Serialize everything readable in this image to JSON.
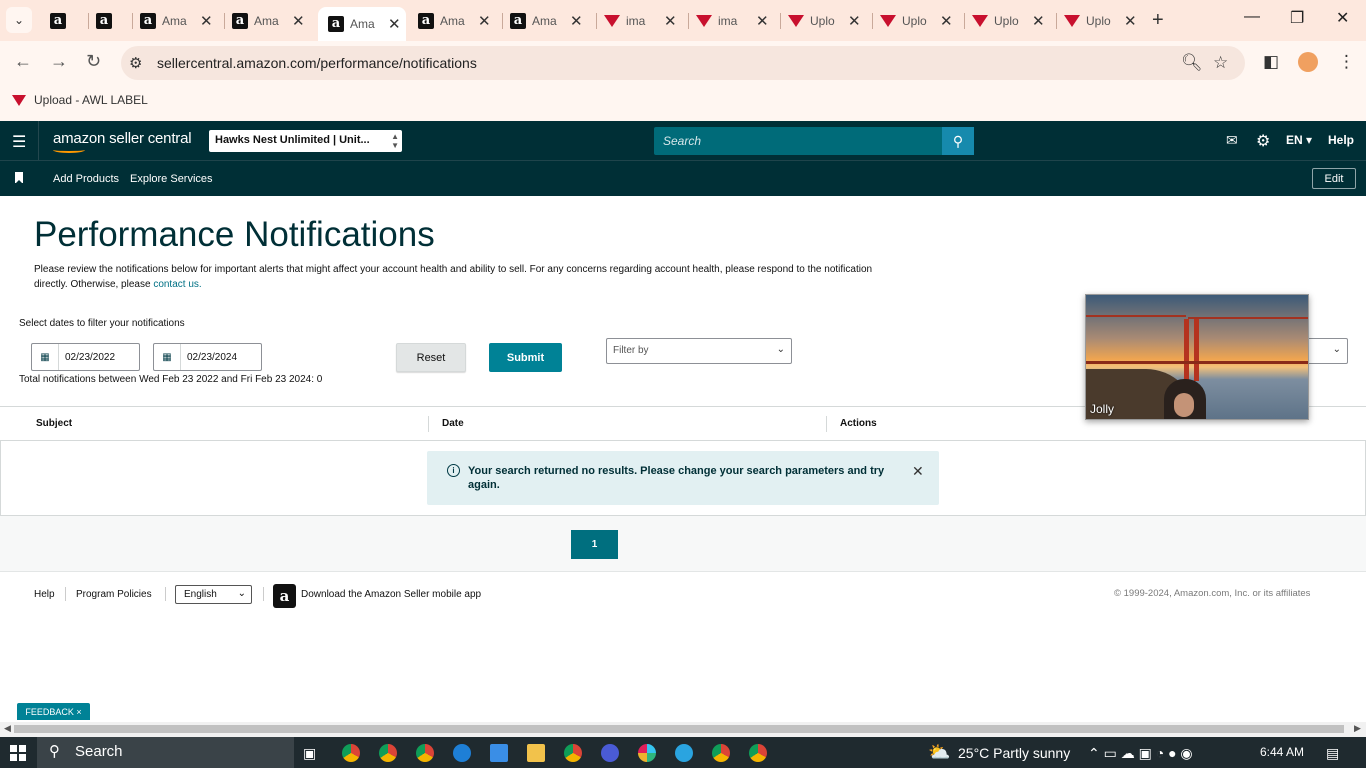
{
  "browser": {
    "tabs": [
      {
        "title": "",
        "icon": "amazon-a-icon"
      },
      {
        "title": "",
        "icon": "amazon-a-icon"
      },
      {
        "title": "Ama",
        "icon": "amazon-a-icon"
      },
      {
        "title": "Ama",
        "icon": "amazon-a-icon"
      },
      {
        "title": "Ama",
        "icon": "amazon-a-icon",
        "active": true
      },
      {
        "title": "Ama",
        "icon": "amazon-a-icon"
      },
      {
        "title": "Ama",
        "icon": "amazon-a-icon"
      },
      {
        "title": "ima",
        "icon": "awl-triangle-icon"
      },
      {
        "title": "ima",
        "icon": "awl-triangle-icon"
      },
      {
        "title": "Uplo",
        "icon": "awl-triangle-icon"
      },
      {
        "title": "Uplo",
        "icon": "awl-triangle-icon"
      },
      {
        "title": "Uplo",
        "icon": "awl-triangle-icon"
      },
      {
        "title": "Uplo",
        "icon": "awl-triangle-icon"
      }
    ],
    "url": "sellercentral.amazon.com/performance/notifications",
    "bookmark_label": "Upload - AWL LABEL",
    "chrome_color": "#fde8de"
  },
  "header": {
    "logo_text": "amazon seller central",
    "account": "Hawks Nest Unlimited | Unit...",
    "search_placeholder": "Search",
    "language": "EN",
    "help": "Help",
    "nav": {
      "add_products": "Add Products",
      "explore_services": "Explore Services",
      "edit": "Edit"
    },
    "bg_color": "#002f36"
  },
  "main": {
    "title": "Performance Notifications",
    "description": "Please review the notifications below for important alerts that might affect your account health and ability to sell. For any concerns regarding account health, please respond to the notification directly. Otherwise, please",
    "contact_link": "contact us.",
    "filter_label": "Select dates to filter your notifications",
    "start_date": "02/23/2022",
    "end_date": "02/23/2024",
    "reset": "Reset",
    "submit": "Submit",
    "filter_by": "Filter by",
    "total": "Total notifications between Wed Feb 23 2022 and Fri Feb 23 2024: 0",
    "columns": [
      "Subject",
      "Date",
      "Actions"
    ],
    "alert": "Your search returned no results. Please change your search parameters and try again.",
    "page": "1",
    "accent_color": "#008296"
  },
  "footer": {
    "help": "Help",
    "program_policies": "Program Policies",
    "language": "English",
    "app_download": "Download the Amazon Seller mobile app",
    "copyright": "© 1999-2024, Amazon.com, Inc. or its affiliates"
  },
  "video_overlay": {
    "name": "Jolly"
  },
  "feedback": "FEEDBACK",
  "taskbar": {
    "search": "Search",
    "weather": "25°C  Partly sunny",
    "time": "6:44 AM"
  }
}
